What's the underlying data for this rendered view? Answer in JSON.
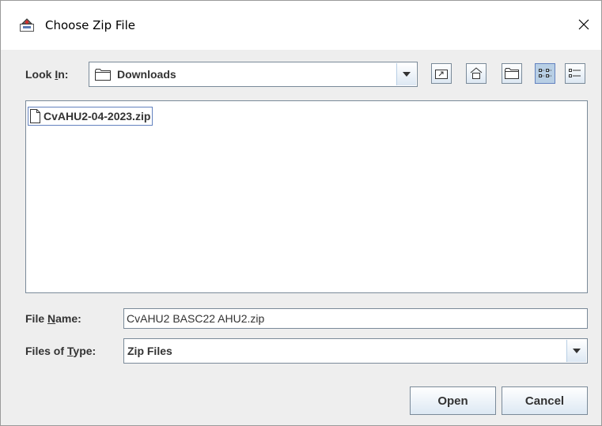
{
  "window": {
    "title": "Choose Zip File"
  },
  "look_in": {
    "label_pre": "Look ",
    "label_mnemonic": "I",
    "label_post": "n:",
    "value": "Downloads"
  },
  "toolbar": {
    "icons": [
      "up-one-level-icon",
      "home-icon",
      "new-folder-icon",
      "list-view-icon",
      "details-view-icon"
    ]
  },
  "files": [
    {
      "name": "CvAHU2-04-2023.zip",
      "selected": true
    }
  ],
  "file_name": {
    "label_pre": "File ",
    "label_mnemonic": "N",
    "label_post": "ame:",
    "value": "CvAHU2 BASC22 AHU2.zip"
  },
  "file_type": {
    "label_pre": "Files of ",
    "label_mnemonic": "T",
    "label_post": "ype:",
    "value": "Zip Files"
  },
  "buttons": {
    "open": "Open",
    "cancel": "Cancel"
  },
  "colors": {
    "accent": "#6382bf",
    "button_gradient_bottom": "#dde8f3",
    "background": "#eeeeee"
  }
}
